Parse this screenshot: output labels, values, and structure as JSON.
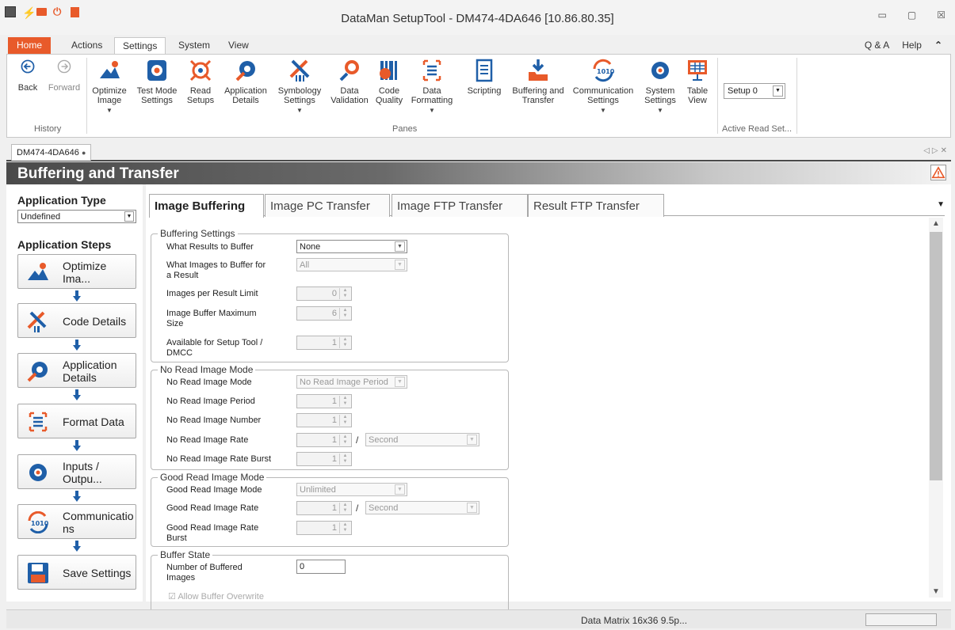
{
  "window": {
    "title": "DataMan SetupTool - DM474-4DA646 [10.86.80.35]",
    "controls": [
      "▭",
      "▢",
      "☒"
    ]
  },
  "menu": {
    "tabs": [
      "Home",
      "Actions",
      "Settings",
      "System",
      "View"
    ],
    "selected": "Settings",
    "right": [
      "Q & A",
      "Help",
      "⌃"
    ]
  },
  "ribbon": {
    "history": {
      "back": "Back",
      "forward": "Forward",
      "group": "History"
    },
    "panes": [
      {
        "label": "Optimize\nImage",
        "dropdown": true
      },
      {
        "label": "Test Mode\nSettings"
      },
      {
        "label": "Read\nSetups"
      },
      {
        "label": "Application\nDetails"
      },
      {
        "label": "Symbology\nSettings",
        "dropdown": true
      },
      {
        "label": "Data\nValidation"
      },
      {
        "label": "Code\nQuality"
      },
      {
        "label": "Data\nFormatting",
        "dropdown": true
      },
      {
        "label": "Scripting"
      },
      {
        "label": "Buffering and\nTransfer"
      },
      {
        "label": "Communication\nSettings",
        "dropdown": true
      },
      {
        "label": "System\nSettings",
        "dropdown": true
      },
      {
        "label": "Table\nView"
      }
    ],
    "panes_group": "Panes",
    "setup_value": "Setup 0",
    "active_group": "Active Read Set..."
  },
  "doc_tab": {
    "label": "DM474-4DA646"
  },
  "pane_title": "Buffering and Transfer",
  "left": {
    "app_type_label": "Application Type",
    "app_type_value": "Undefined",
    "steps_label": "Application Steps",
    "steps": [
      {
        "label": "Optimize Ima...",
        "icon": "optimize-icon"
      },
      {
        "label": "Code Details",
        "icon": "code-details-icon"
      },
      {
        "label": "Application\nDetails",
        "icon": "application-icon"
      },
      {
        "label": "Format Data",
        "icon": "format-icon"
      },
      {
        "label": "Inputs / Outpu...",
        "icon": "gear-icon"
      },
      {
        "label": "Communicatio\nns",
        "icon": "communication-icon"
      },
      {
        "label": "Save Settings",
        "icon": "floppy-icon"
      }
    ]
  },
  "content_tabs": [
    "Image Buffering",
    "Image PC Transfer",
    "Image FTP Transfer",
    "Result FTP Transfer"
  ],
  "buffering": {
    "title": "Buffering Settings",
    "what_results_label": "What Results to Buffer",
    "what_results_value": "None",
    "what_images_label": "What Images to Buffer for\na Result",
    "what_images_value": "All",
    "images_per_result_label": "Images per Result Limit",
    "images_per_result_value": "0",
    "buffer_max_label": "Image Buffer Maximum\nSize",
    "buffer_max_value": "6",
    "available_label": "Available for Setup Tool /\nDMCC",
    "available_value": "1"
  },
  "no_read": {
    "title": "No Read Image Mode",
    "mode_label": "No Read Image Mode",
    "mode_value": "No Read Image Period",
    "period_label": "No Read Image Period",
    "period_value": "1",
    "number_label": "No Read Image Number",
    "number_value": "1",
    "rate_label": "No Read Image Rate",
    "rate_value": "1",
    "rate_unit": "Second",
    "burst_label": "No Read Image Rate Burst",
    "burst_value": "1"
  },
  "good_read": {
    "title": "Good Read Image Mode",
    "mode_label": "Good Read Image Mode",
    "mode_value": "Unlimited",
    "rate_label": "Good Read Image Rate",
    "rate_value": "1",
    "rate_unit": "Second",
    "burst_label": "Good Read Image Rate\nBurst",
    "burst_value": "1"
  },
  "buffer_state": {
    "title": "Buffer State",
    "count_label": "Number of Buffered\nImages",
    "count_value": "0",
    "overwrite_label": "Allow Buffer Overwrite"
  },
  "slash": "/",
  "status": {
    "message": "Data Matrix 16x36 9.5p..."
  }
}
